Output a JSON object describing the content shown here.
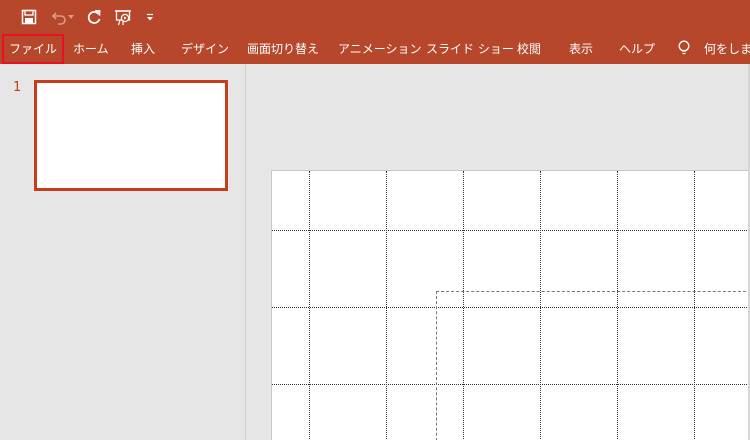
{
  "quick_access": {
    "icons": [
      "save-icon",
      "undo-icon",
      "redo-icon",
      "start-from-beginning-icon",
      "customize-dropdown-icon"
    ]
  },
  "ribbon": {
    "tabs": [
      {
        "label": "ファイル"
      },
      {
        "label": "ホーム"
      },
      {
        "label": "挿入"
      },
      {
        "label": "デザイン"
      },
      {
        "label": "画面切り替え"
      },
      {
        "label": "アニメーション"
      },
      {
        "label": "スライド ショー"
      },
      {
        "label": "校閲"
      },
      {
        "label": "表示"
      },
      {
        "label": "ヘルプ"
      }
    ],
    "tell_me": "何をしますか"
  },
  "thumbnails": {
    "slides": [
      {
        "number": "1"
      }
    ]
  },
  "colors": {
    "accent": "#b7472a",
    "selection": "#c43e1c",
    "highlight_box": "#e81123"
  }
}
